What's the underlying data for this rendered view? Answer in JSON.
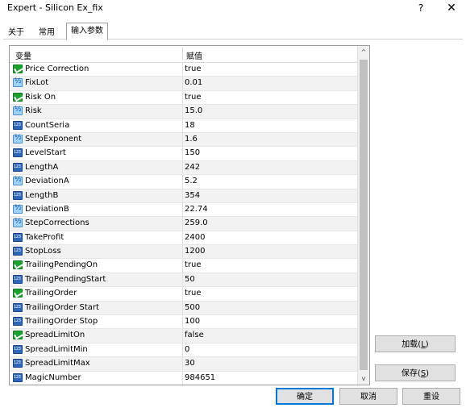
{
  "window": {
    "title": "Expert - Silicon Ex_fix",
    "help_label": "?",
    "close_label": "✕"
  },
  "tabs": {
    "about": "关于",
    "common": "常用",
    "inputs": "输入参数"
  },
  "grid": {
    "header": {
      "variable": "变量",
      "value": "赋值"
    },
    "rows": [
      {
        "type": "bool",
        "name": "Price Correction",
        "value": "true"
      },
      {
        "type": "double",
        "name": "FixLot",
        "value": "0.01"
      },
      {
        "type": "bool",
        "name": "Risk On",
        "value": "true"
      },
      {
        "type": "double",
        "name": "Risk",
        "value": "15.0"
      },
      {
        "type": "int",
        "name": "CountSeria",
        "value": "18"
      },
      {
        "type": "double",
        "name": "StepExponent",
        "value": "1.6"
      },
      {
        "type": "int",
        "name": "LevelStart",
        "value": "150"
      },
      {
        "type": "int",
        "name": "LengthA",
        "value": "242"
      },
      {
        "type": "double",
        "name": "DeviationA",
        "value": "5.2"
      },
      {
        "type": "int",
        "name": "LengthB",
        "value": "354"
      },
      {
        "type": "double",
        "name": "DeviationB",
        "value": "22.74"
      },
      {
        "type": "double",
        "name": "StepCorrections",
        "value": "259.0"
      },
      {
        "type": "int",
        "name": "TakeProfit",
        "value": "2400"
      },
      {
        "type": "int",
        "name": "StopLoss",
        "value": "1200"
      },
      {
        "type": "bool",
        "name": "TrailingPendingOn",
        "value": "true"
      },
      {
        "type": "int",
        "name": "TrailingPendingStart",
        "value": "50"
      },
      {
        "type": "bool",
        "name": "TrailingOrder",
        "value": "true"
      },
      {
        "type": "int",
        "name": "TrailingOrder Start",
        "value": "500"
      },
      {
        "type": "int",
        "name": "TrailingOrder Stop",
        "value": "100"
      },
      {
        "type": "bool",
        "name": "SpreadLimitOn",
        "value": "false"
      },
      {
        "type": "int",
        "name": "SpreadLimitMin",
        "value": "0"
      },
      {
        "type": "int",
        "name": "SpreadLimitMax",
        "value": "30"
      },
      {
        "type": "int",
        "name": "MagicNumber",
        "value": "984651"
      }
    ]
  },
  "scrollbar": {
    "up_label": "^",
    "down_label": "v"
  },
  "buttons": {
    "load_text": "加载(",
    "load_key": "L",
    "load_close": ")",
    "save_text": "保存(",
    "save_key": "S",
    "save_close": ")",
    "ok": "确定",
    "cancel": "取消",
    "reset": "重设"
  },
  "icons": {
    "bool": "bool-toggle-icon",
    "double": "double-value-icon",
    "int": "integer-value-icon"
  },
  "colors": {
    "accent": "#0078d7",
    "bool_icon": "#1aa12e",
    "int_icon": "#2d67b8",
    "double_icon": "#9fd2ff"
  }
}
